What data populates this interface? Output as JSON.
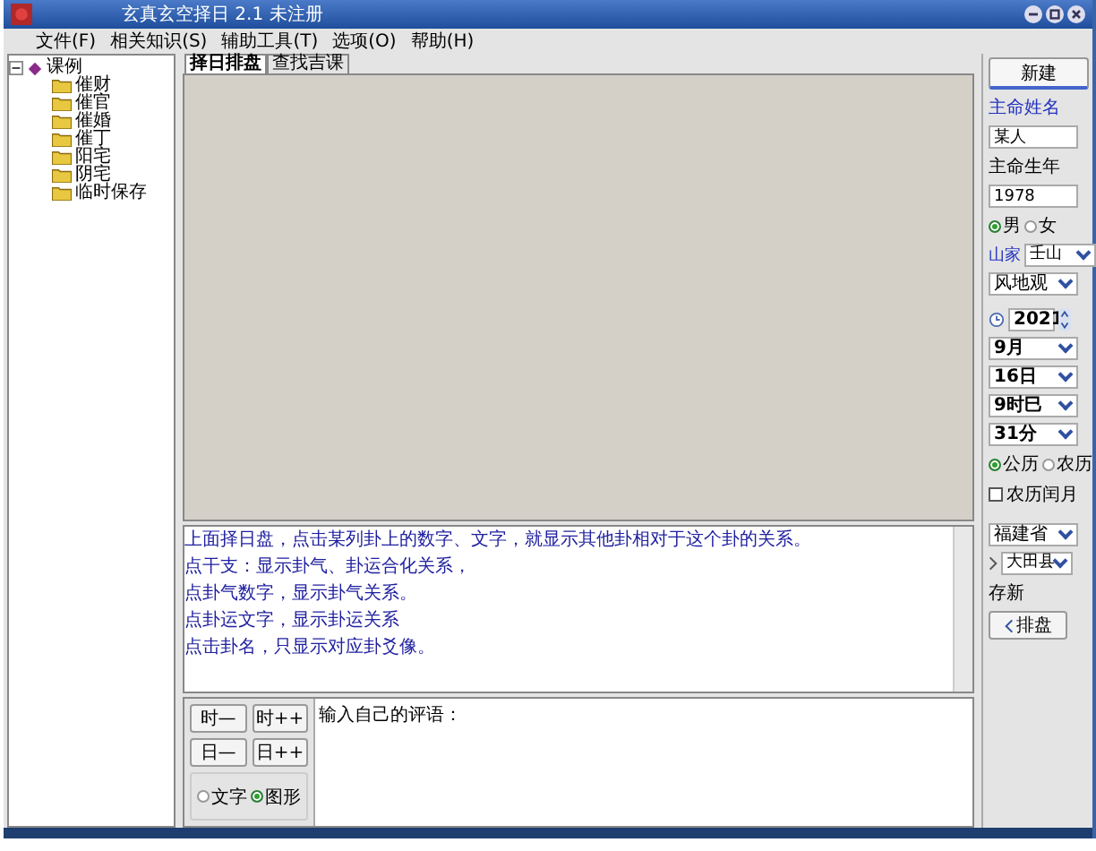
{
  "window": {
    "title": "玄真玄空择日 2.1 未注册"
  },
  "menu": [
    "文件(F)",
    "相关知识(S)",
    "辅助工具(T)",
    "选项(O)",
    "帮助(H)"
  ],
  "tree": {
    "label": "课例",
    "expanded": true,
    "children": [
      {
        "label": "催财"
      },
      {
        "label": "催官"
      },
      {
        "label": "催婚"
      },
      {
        "label": "催丁"
      },
      {
        "label": "阳宅"
      },
      {
        "label": "阴宅"
      },
      {
        "label": "临时保存"
      }
    ]
  },
  "tabs": [
    {
      "label": "择日排盘",
      "selected": true
    },
    {
      "label": "查找吉课",
      "selected": false
    }
  ],
  "info_lines": [
    "上面择日盘，点击某列卦上的数字、文字，就显示其他卦相对于这个卦的关系。",
    "点干支：显示卦气、卦运合化关系，",
    "点卦气数字，显示卦气关系。",
    "点卦运文字，显示卦运关系",
    "点击卦名，只显示对应卦爻像。"
  ],
  "step_buttons": [
    "时—",
    "时++",
    "日—",
    "日++"
  ],
  "display_mode": [
    {
      "label": "文字",
      "selected": false
    },
    {
      "label": "图形",
      "selected": true
    }
  ],
  "comment_box": {
    "value": "输入自己的评语："
  },
  "side": {
    "new_button": "新建",
    "name_label": "主命姓名",
    "name_value": "某人",
    "birth_label": "主命生年",
    "birth_value": "1978",
    "gender": [
      {
        "label": "男",
        "selected": true
      },
      {
        "label": "女",
        "selected": false
      }
    ],
    "shan_label": "山家",
    "shan_value": "壬山",
    "school": "风地观",
    "year": "2021",
    "month": "9月",
    "day": "16日",
    "hour": "9时巳",
    "minute": "31分",
    "calendar": [
      {
        "label": "公历",
        "selected": true
      },
      {
        "label": "农历",
        "selected": false
      }
    ],
    "leap_month": {
      "label": "农历闰月",
      "checked": false
    },
    "province": "福建省",
    "county": "大田县",
    "save_label": "存新",
    "chart_button": "排盘"
  }
}
